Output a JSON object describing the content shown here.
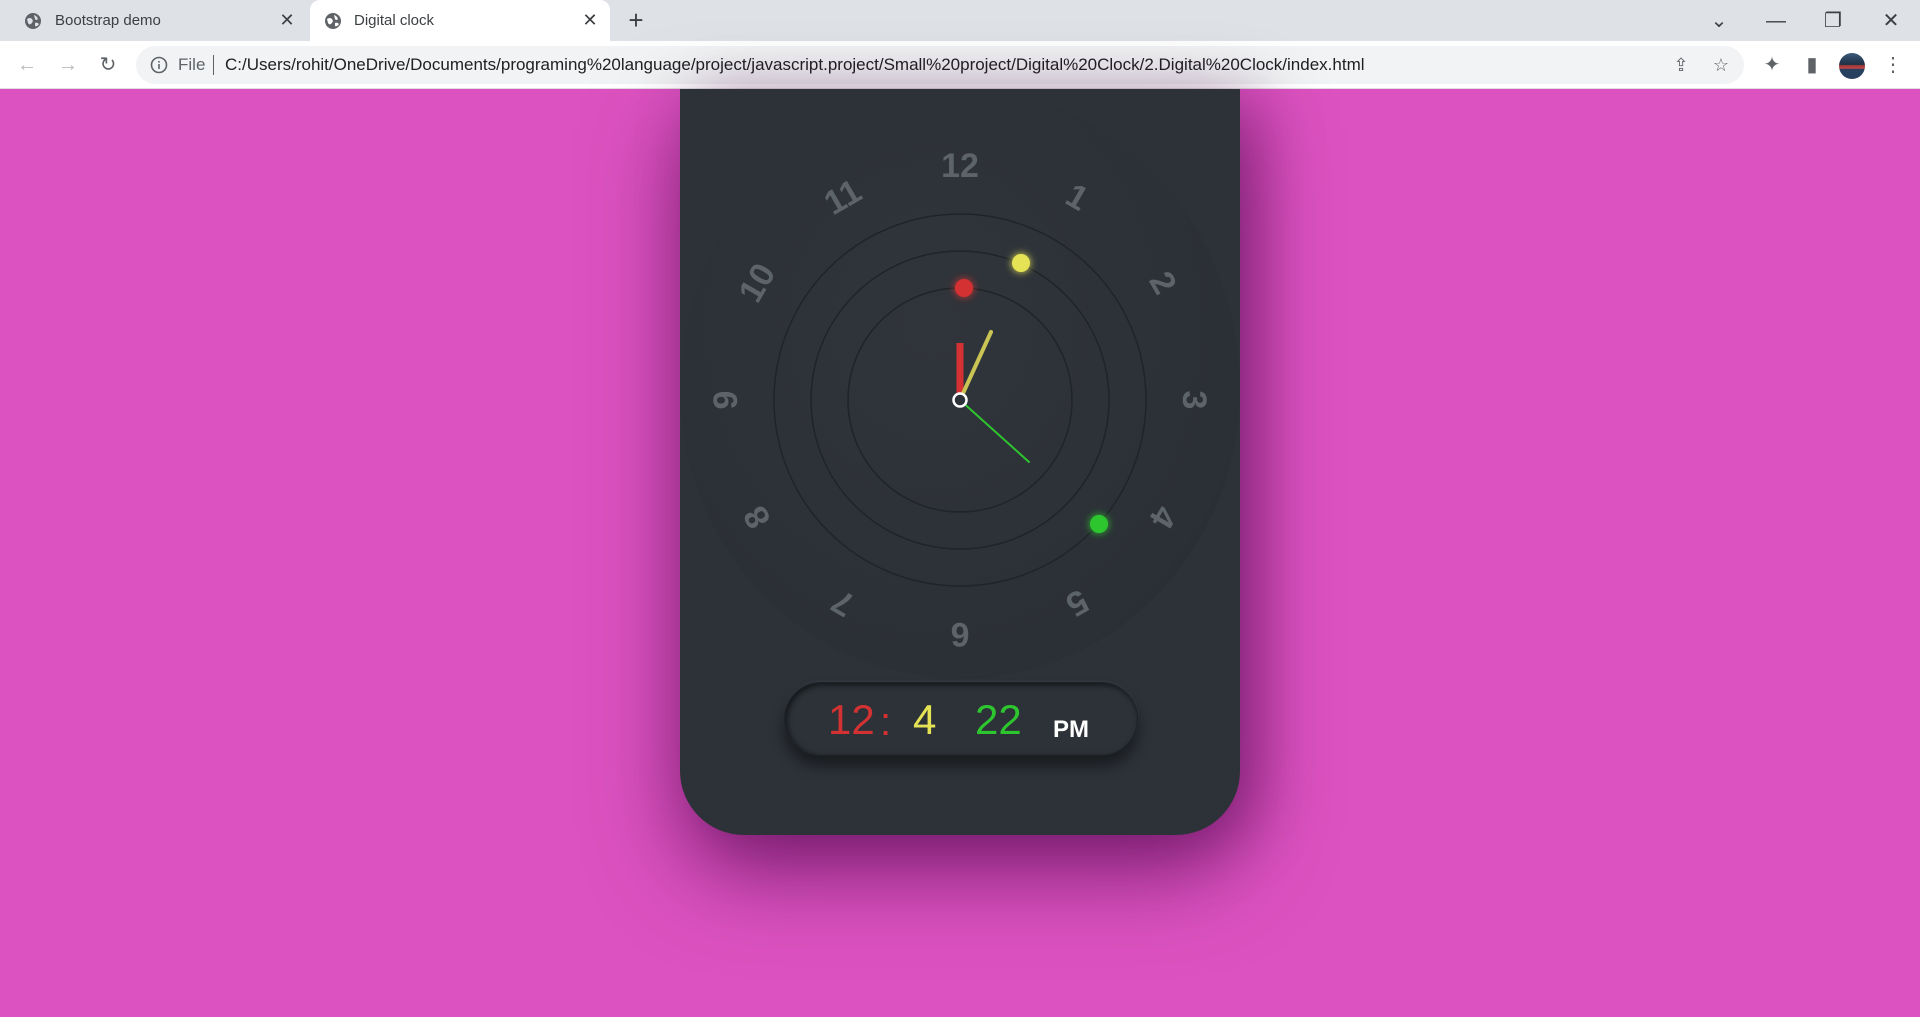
{
  "browser": {
    "tabs": [
      {
        "title": "Bootstrap demo",
        "active": false
      },
      {
        "title": "Digital clock",
        "active": true
      }
    ],
    "new_tab_label": "+",
    "address": {
      "scheme_label": "File",
      "url": "C:/Users/rohit/OneDrive/Documents/programing%20language/project/javascript.project/Small%20project/Digital%20Clock/2.Digital%20Clock/index.html"
    }
  },
  "page": {
    "background_color": "#dc52c0",
    "clock": {
      "numerals": [
        "12",
        "1",
        "2",
        "3",
        "4",
        "5",
        "6",
        "7",
        "8",
        "9",
        "10",
        "11"
      ],
      "hand_colors": {
        "hour": "#d43232",
        "minute": "#e6e255",
        "second": "#2ec62e"
      },
      "digital": {
        "hours": "12",
        "separator": ":",
        "minutes": "4",
        "seconds": "22",
        "ampm": "PM"
      }
    }
  }
}
